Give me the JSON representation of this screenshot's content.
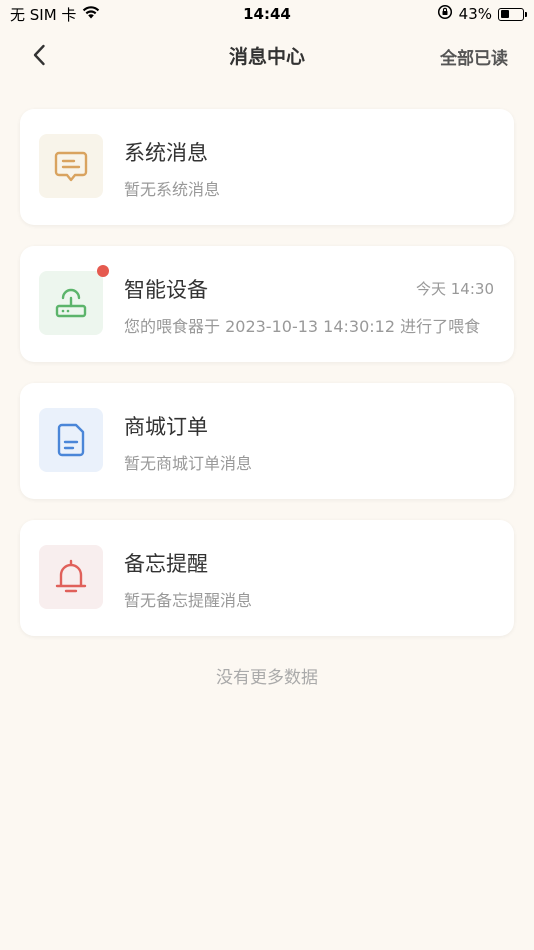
{
  "status_bar": {
    "carrier": "无 SIM 卡",
    "time": "14:44",
    "battery_percent": "43%",
    "battery_level": 0.43
  },
  "nav": {
    "title": "消息中心",
    "mark_all_read": "全部已读"
  },
  "items": [
    {
      "title": "系统消息",
      "subtitle": "暂无系统消息",
      "time": "",
      "unread": false,
      "icon": "message-icon",
      "color": "#d9a35f",
      "bg": "#f8f4ea"
    },
    {
      "title": "智能设备",
      "subtitle": "您的喂食器于 2023-10-13 14:30:12 进行了喂食",
      "time": "今天 14:30",
      "unread": true,
      "icon": "device-icon",
      "color": "#5cb46b",
      "bg": "#edf6ee"
    },
    {
      "title": "商城订单",
      "subtitle": "暂无商城订单消息",
      "time": "",
      "unread": false,
      "icon": "order-icon",
      "color": "#4a86d8",
      "bg": "#eaf1fb"
    },
    {
      "title": "备忘提醒",
      "subtitle": "暂无备忘提醒消息",
      "time": "",
      "unread": false,
      "icon": "bell-icon",
      "color": "#e0605a",
      "bg": "#f8eeee"
    }
  ],
  "footer": {
    "no_more": "没有更多数据"
  }
}
